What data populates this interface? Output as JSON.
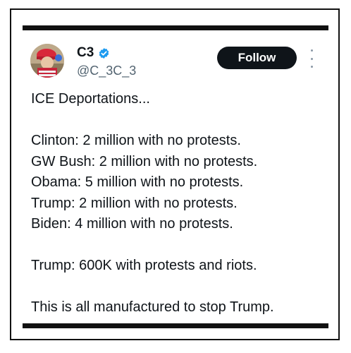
{
  "author": {
    "name": "C3",
    "handle": "@C_3C_3",
    "verified": true,
    "verified_color": "#1d9bf0"
  },
  "follow_button": {
    "label": "Follow"
  },
  "more_menu": {
    "icon": "more-vertical-icon"
  },
  "tweet": {
    "heading": "ICE Deportations...",
    "stats": [
      "Clinton: 2 million with no protests.",
      "GW Bush: 2 million with no protests.",
      "Obama: 5 million with no protests.",
      "Trump: 2 million with no protests.",
      "Biden: 4 million with no protests."
    ],
    "current": "Trump: 600K with protests and riots.",
    "conclusion": "This is all manufactured to stop Trump."
  },
  "colors": {
    "text": "#0f1419",
    "secondary": "#536471",
    "button_bg": "#0f1419",
    "frame": "#111111"
  }
}
